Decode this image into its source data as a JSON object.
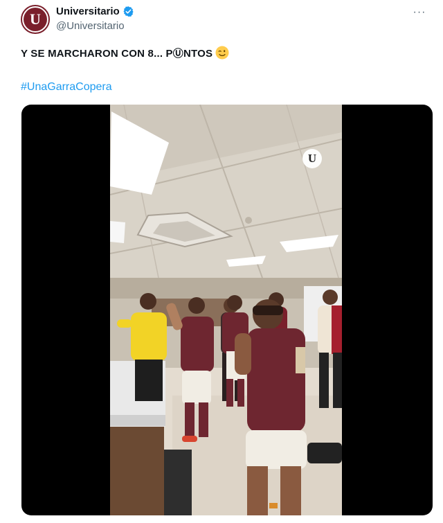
{
  "account": {
    "display_name": "Universitario",
    "handle": "@Universitario",
    "avatar_letter": "U",
    "verified": true
  },
  "post": {
    "text": "Y SE MARCHARON CON 8... PⓊNTOS",
    "emoji": "winking-face",
    "hashtag": "#UnaGarraCopera"
  },
  "media": {
    "type": "video",
    "overlay_logo_letter": "U"
  },
  "menu": {
    "more_label": "···"
  },
  "colors": {
    "brand": "#7a1f2b",
    "link": "#1d9bf0",
    "verified": "#1d9bf0",
    "secondary_text": "#536471"
  }
}
